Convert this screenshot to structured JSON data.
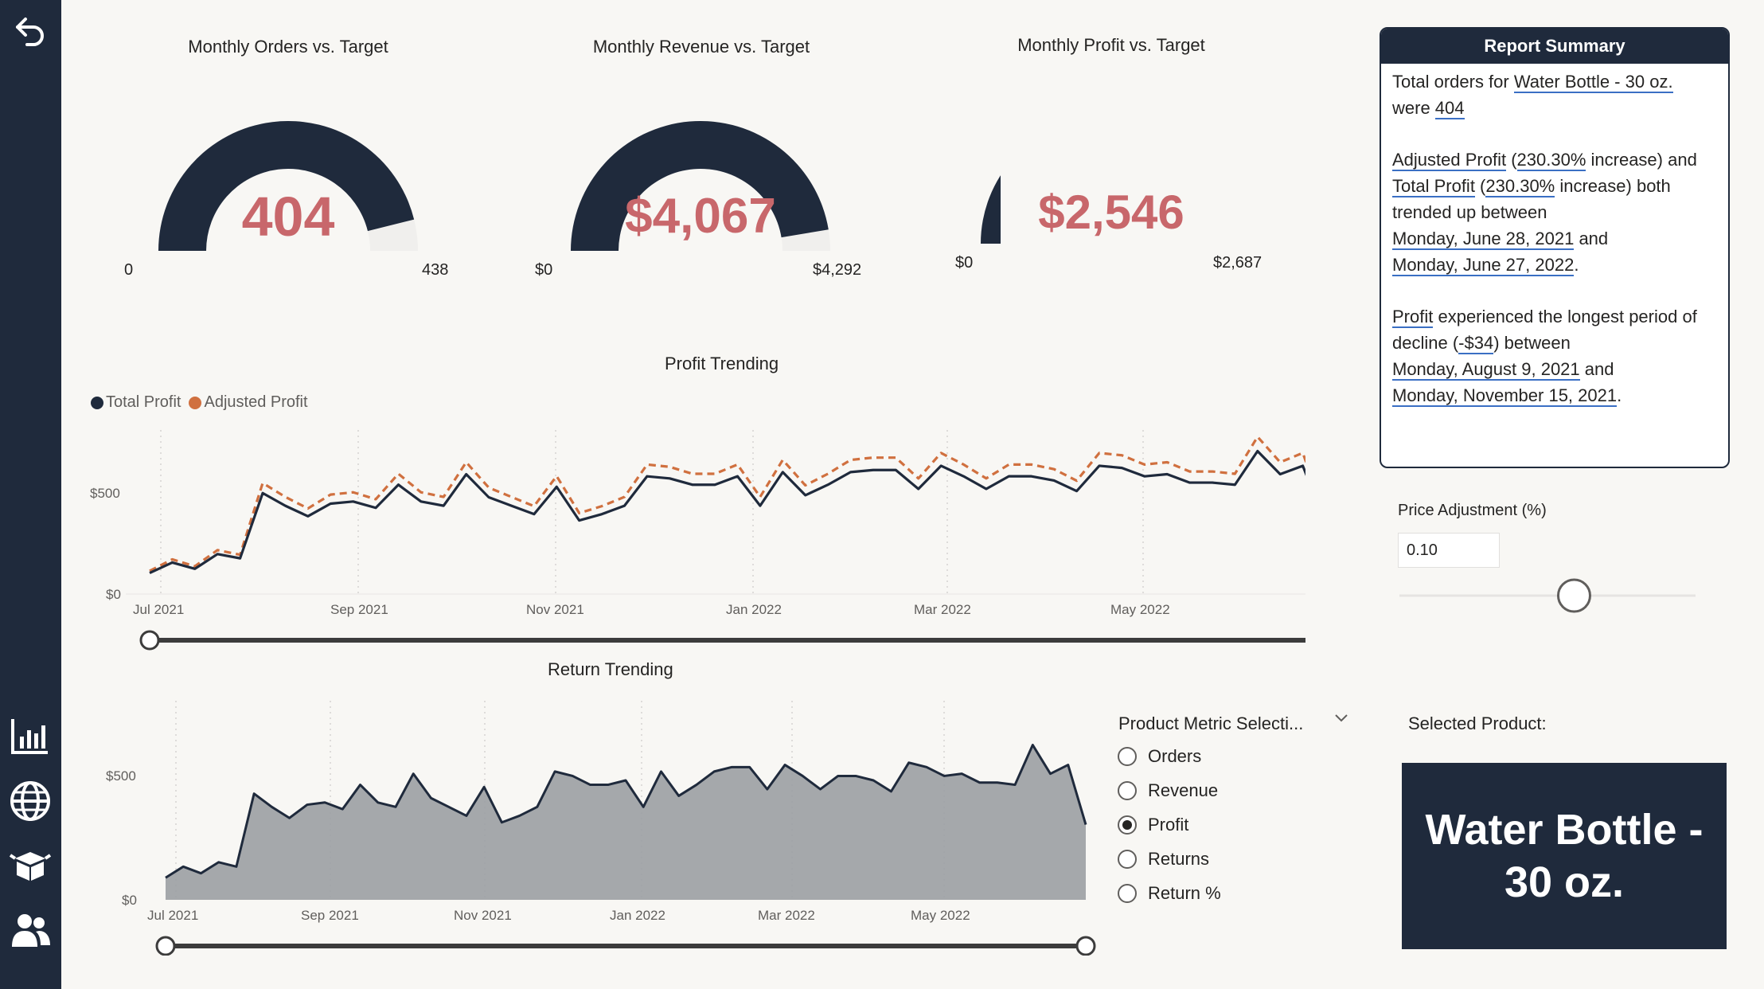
{
  "sidebar": {
    "icons": [
      "back-arrow-icon",
      "bar-chart-icon",
      "globe-icon",
      "box-icon",
      "people-icon"
    ]
  },
  "gauges": [
    {
      "title": "Monthly Orders vs. Target",
      "value_text": "404",
      "value": 404,
      "min_label": "0",
      "max_label": "438",
      "max": 438
    },
    {
      "title": "Monthly Revenue vs. Target",
      "value_text": "$4,067",
      "value": 4067,
      "min_label": "$0",
      "max_label": "$4,292",
      "max": 4292
    },
    {
      "title": "Monthly Profit vs. Target",
      "value_text": "$2,546",
      "value": 2546,
      "min_label": "$0",
      "max_label": "$2,687",
      "max": 2687
    }
  ],
  "profit_chart": {
    "title": "Profit Trending",
    "legend": [
      "Total Profit",
      "Adjusted Profit"
    ],
    "y_ticks": [
      "$500",
      "$0"
    ],
    "x_ticks": [
      "Jul 2021",
      "Sep 2021",
      "Nov 2021",
      "Jan 2022",
      "Mar 2022",
      "May 2022"
    ]
  },
  "return_chart": {
    "title": "Return Trending",
    "y_ticks": [
      "$500",
      "$0"
    ],
    "x_ticks": [
      "Jul 2021",
      "Sep 2021",
      "Nov 2021",
      "Jan 2022",
      "Mar 2022",
      "May 2022"
    ]
  },
  "chart_data": [
    {
      "type": "line",
      "title": "Profit Trending",
      "ylim": [
        0,
        750
      ],
      "y_tick_values": [
        0,
        500
      ],
      "legend_position": "top-left",
      "grid": "vertical dotted",
      "series": [
        {
          "name": "Total Profit",
          "color": "#1f2a3c",
          "dash": "solid",
          "values": [
            100,
            150,
            120,
            190,
            170,
            480,
            420,
            370,
            430,
            440,
            410,
            520,
            440,
            420,
            570,
            460,
            420,
            380,
            510,
            350,
            380,
            420,
            560,
            550,
            520,
            520,
            560,
            420,
            580,
            470,
            520,
            580,
            590,
            590,
            500,
            610,
            560,
            500,
            560,
            560,
            540,
            490,
            610,
            600,
            560,
            570,
            530,
            530,
            520,
            680,
            570,
            610,
            340
          ]
        },
        {
          "name": "Adjusted Profit",
          "color": "#d0703f",
          "dash": "dashed",
          "values": [
            110,
            165,
            132,
            209,
            187,
            528,
            462,
            407,
            473,
            484,
            451,
            572,
            484,
            462,
            627,
            506,
            462,
            418,
            561,
            385,
            418,
            462,
            616,
            605,
            572,
            572,
            616,
            462,
            638,
            517,
            572,
            638,
            649,
            649,
            550,
            671,
            616,
            550,
            616,
            616,
            594,
            539,
            671,
            660,
            616,
            627,
            583,
            583,
            572,
            748,
            627,
            671,
            374
          ]
        }
      ]
    },
    {
      "type": "area",
      "title": "Return Trending",
      "ylim": [
        0,
        900
      ],
      "y_tick_values": [
        0,
        500
      ],
      "grid": "vertical dotted",
      "series": [
        {
          "name": "",
          "color": "#9b9ea3",
          "values": [
            100,
            150,
            120,
            170,
            150,
            480,
            420,
            370,
            430,
            440,
            410,
            520,
            440,
            420,
            570,
            460,
            420,
            380,
            510,
            350,
            380,
            420,
            580,
            560,
            520,
            520,
            540,
            420,
            580,
            470,
            520,
            580,
            600,
            600,
            500,
            610,
            560,
            500,
            560,
            560,
            540,
            490,
            620,
            600,
            560,
            570,
            530,
            530,
            520,
            700,
            570,
            610,
            340
          ]
        }
      ]
    }
  ],
  "summary": {
    "title": "Report Summary",
    "p1_a": "Total orders for ",
    "p1_product": "Water Bottle - 30 oz.",
    "p1_b": "were ",
    "p1_count": "404",
    "p2_a": "Adjusted Profit",
    "p2_pct1": "230.30%",
    "p2_b_pre": " (",
    "p2_b_post": " increase) and",
    "p2_c": "Total Profit",
    "p2_pct2": "230.30%",
    "p2_d_post": " increase) both",
    "p2_e": "trended up between",
    "p2_date1": "Monday, June 28, 2021",
    "p2_and": " and",
    "p2_date2": "Monday, June 27, 2022",
    "p2_end": ".",
    "p3_a": "Profit",
    "p3_b": " experienced the longest period of",
    "p3_c": "decline (",
    "p3_amt": "-$34",
    "p3_d": ") between",
    "p3_date1": "Monday, August 9, 2021",
    "p3_and": " and",
    "p3_date2": "Monday, November 15, 2021",
    "p3_end": "."
  },
  "price_adjustment": {
    "label": "Price Adjustment (%)",
    "value": "0.10",
    "slider_fraction": 0.59
  },
  "metric_selection": {
    "label": "Product Metric Selecti...",
    "options": [
      "Orders",
      "Revenue",
      "Profit",
      "Returns",
      "Return %"
    ],
    "selected": "Profit"
  },
  "selected_product": {
    "label": "Selected Product:",
    "line1": "Water Bottle -",
    "line2": "30 oz."
  }
}
